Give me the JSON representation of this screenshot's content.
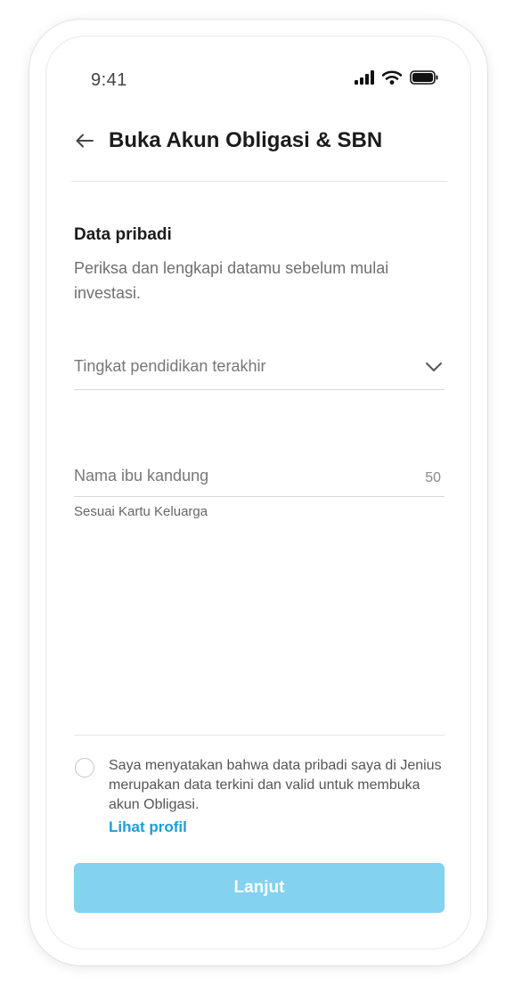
{
  "status_bar": {
    "time": "9:41"
  },
  "header": {
    "title": "Buka Akun Obligasi & SBN"
  },
  "section": {
    "title": "Data pribadi",
    "description": "Periksa dan lengkapi datamu sebelum mulai investasi."
  },
  "form": {
    "education": {
      "placeholder": "Tingkat pendidikan terakhir"
    },
    "mother_name": {
      "placeholder": "Nama ibu kandung",
      "counter": "50",
      "helper": "Sesuai Kartu Keluarga"
    }
  },
  "consent": {
    "text": "Saya menyatakan bahwa data pribadi saya di Jenius merupakan data terkini dan valid untuk membuka akun Obligasi.",
    "link": "Lihat profil"
  },
  "primary_button": {
    "label": "Lanjut"
  },
  "colors": {
    "accent": "#1a9fd8",
    "button_disabled": "#83d2ef"
  }
}
